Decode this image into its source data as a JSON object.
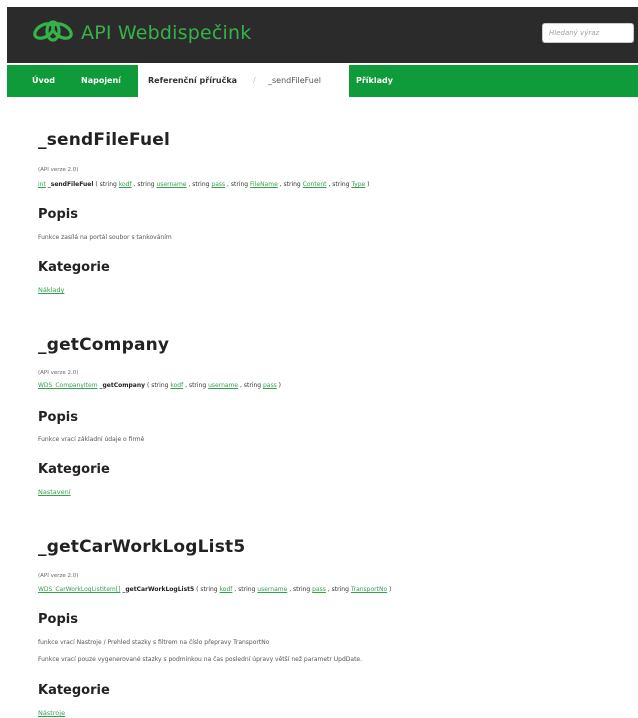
{
  "header": {
    "title": "API Webdispečink",
    "search_placeholder": "Hledaný výraz",
    "logo_icon": "carbon-logo-icon",
    "colors": {
      "dark": "#2b2b2b",
      "accent": "#35b34a",
      "nav": "#109b3a"
    }
  },
  "nav": {
    "uvod": "Úvod",
    "napojeni": "Napojení",
    "referencni": "Referenční příručka",
    "separator": "/",
    "current": "_sendFileFuel",
    "priklady": "Příklady"
  },
  "sections": [
    {
      "title": "_sendFileFuel",
      "version": "(API verze 2.0)",
      "return_type": "int",
      "func": "_sendFileFuel",
      "params": [
        {
          "type": "string",
          "name": "kodf"
        },
        {
          "type": "string",
          "name": "username"
        },
        {
          "type": "string",
          "name": "pass"
        },
        {
          "type": "string",
          "name": "FileName"
        },
        {
          "type": "string",
          "name": "Content"
        },
        {
          "type": "string",
          "name": "Type"
        }
      ],
      "popis_label": "Popis",
      "popis": [
        "Funkce zasílá na portál soubor s tankováním"
      ],
      "kategorie_label": "Kategorie",
      "kategorie": "Náklady"
    },
    {
      "title": "_getCompany",
      "version": "(API verze 2.0)",
      "return_type": "WDS_CompanyItem",
      "func": "_getCompany",
      "params": [
        {
          "type": "string",
          "name": "kodf"
        },
        {
          "type": "string",
          "name": "username"
        },
        {
          "type": "string",
          "name": "pass"
        }
      ],
      "popis_label": "Popis",
      "popis": [
        "Funkce vrací základní údaje o firmě"
      ],
      "kategorie_label": "Kategorie",
      "kategorie": "Nastavení"
    },
    {
      "title": "_getCarWorkLogList5",
      "version": "(API verze 2.0)",
      "return_type": "WDS_CarWorkLogListItem[]",
      "func": "_getCarWorkLogList5",
      "params": [
        {
          "type": "string",
          "name": "kodf"
        },
        {
          "type": "string",
          "name": "username"
        },
        {
          "type": "string",
          "name": "pass"
        },
        {
          "type": "string",
          "name": "TransportNo"
        }
      ],
      "popis_label": "Popis",
      "popis": [
        "funkce vrací Nastroje / Prehled stazky s filtrem na číslo přepravy TransportNo",
        "Funkce vrací pouze vygenerované stazky s podmínkou na čas poslední úpravy větší než parametr UpdDate."
      ],
      "kategorie_label": "Kategorie",
      "kategorie": "Nástroje"
    }
  ]
}
